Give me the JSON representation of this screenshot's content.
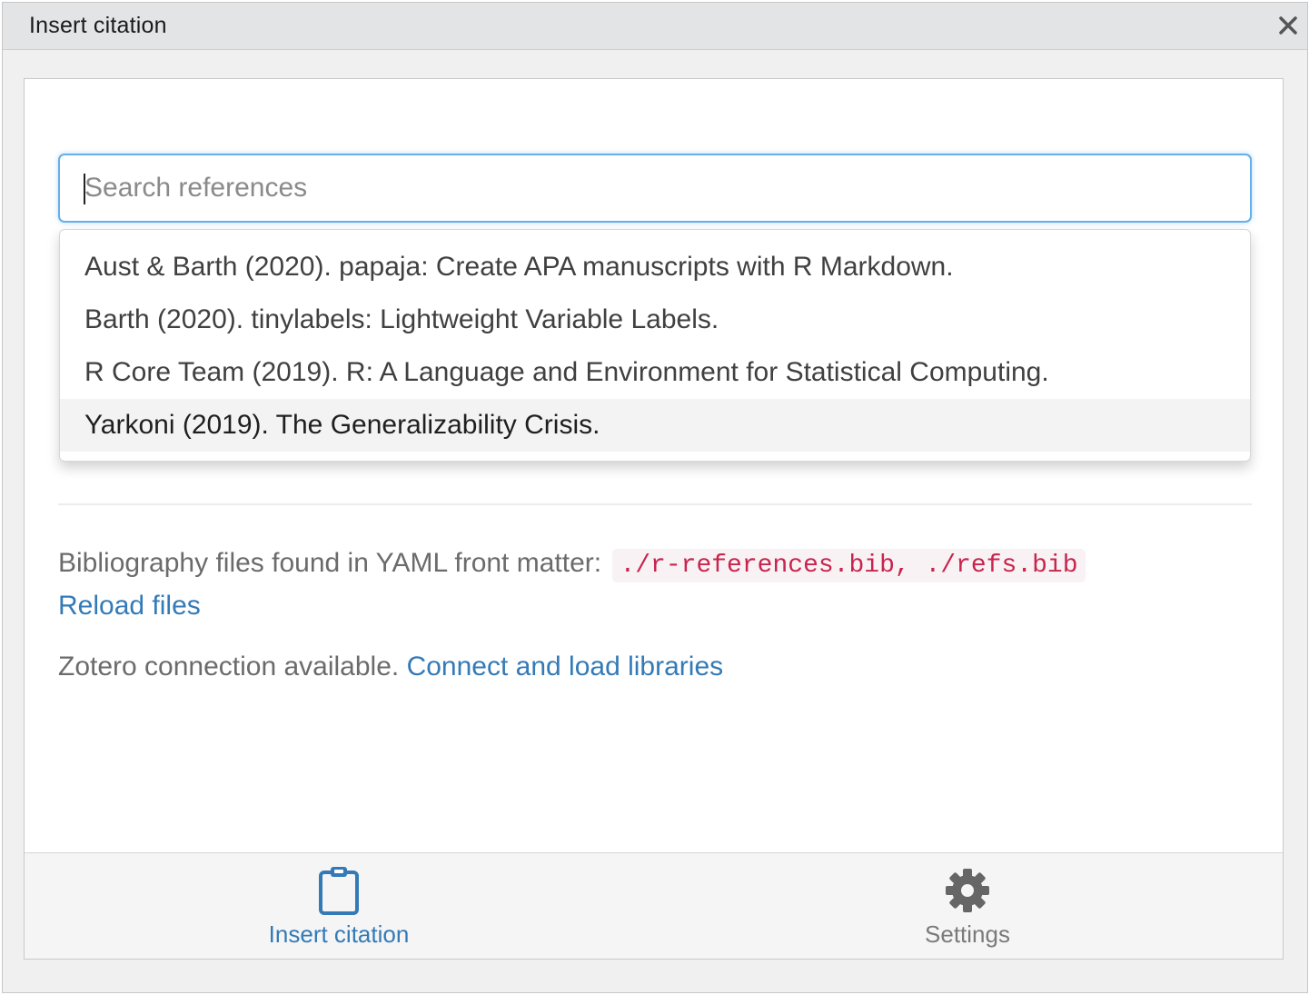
{
  "window": {
    "title": "Insert citation"
  },
  "search": {
    "placeholder": "Search references",
    "value": ""
  },
  "references": [
    {
      "label": "Aust & Barth (2020). papaja: Create APA manuscripts with R Markdown.",
      "highlighted": false
    },
    {
      "label": "Barth (2020). tinylabels: Lightweight Variable Labels.",
      "highlighted": false
    },
    {
      "label": "R Core Team (2019). R: A Language and Environment for Statistical Computing.",
      "highlighted": false
    },
    {
      "label": "Yarkoni (2019). The Generalizability Crisis.",
      "highlighted": true
    }
  ],
  "bibliography": {
    "label": "Bibliography files found in YAML front matter:",
    "files": "./r-references.bib, ./refs.bib",
    "reload_label": "Reload files"
  },
  "zotero": {
    "status": "Zotero connection available.",
    "connect_label": "Connect and load libraries"
  },
  "footer": {
    "insert": {
      "label": "Insert citation",
      "icon": "clipboard-icon"
    },
    "settings": {
      "label": "Settings",
      "icon": "gear-icon"
    }
  },
  "colors": {
    "accent": "#337ab7",
    "focus": "#66afe9",
    "code_text": "#c7254e",
    "code_bg": "#f9f2f4"
  }
}
